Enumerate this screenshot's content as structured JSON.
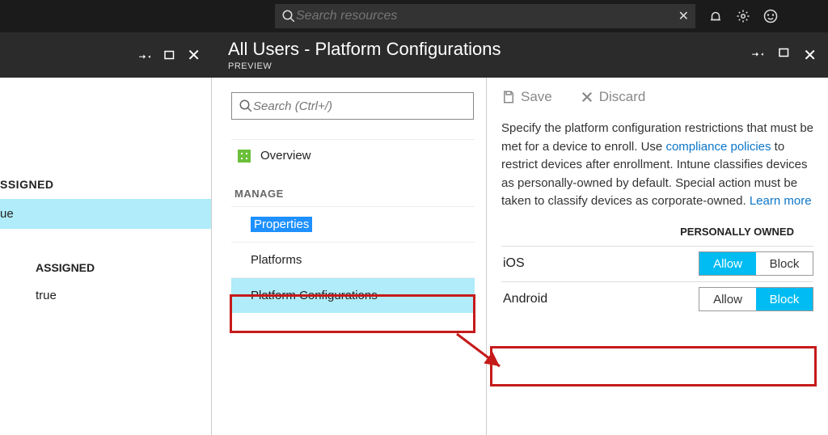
{
  "global_search": {
    "placeholder": "Search resources"
  },
  "blade": {
    "title": "All Users - Platform Configurations",
    "subtitle": "PREVIEW"
  },
  "left": {
    "section": "SSIGNED",
    "selected_value": "ue",
    "sub_section": "ASSIGNED",
    "sub_value": "true"
  },
  "mid": {
    "search_placeholder": "Search (Ctrl+/)",
    "overview": "Overview",
    "manage": "MANAGE",
    "items": [
      {
        "label": "Properties"
      },
      {
        "label": "Platforms"
      },
      {
        "label": "Platform Configurations"
      }
    ]
  },
  "right": {
    "save": "Save",
    "discard": "Discard",
    "desc1": "Specify the platform configuration restrictions that must be met for a device to enroll. Use ",
    "link1": "compliance policies",
    "desc2": " to restrict devices after enrollment. Intune classifies devices as personally-owned by default. Special action must be taken to classify devices as corporate-owned. ",
    "link2": "Learn more",
    "col_header": "PERSONALLY OWNED",
    "platforms": [
      {
        "name": "iOS",
        "allow": "Allow",
        "block": "Block",
        "state": "allow"
      },
      {
        "name": "Android",
        "allow": "Allow",
        "block": "Block",
        "state": "block"
      }
    ]
  }
}
